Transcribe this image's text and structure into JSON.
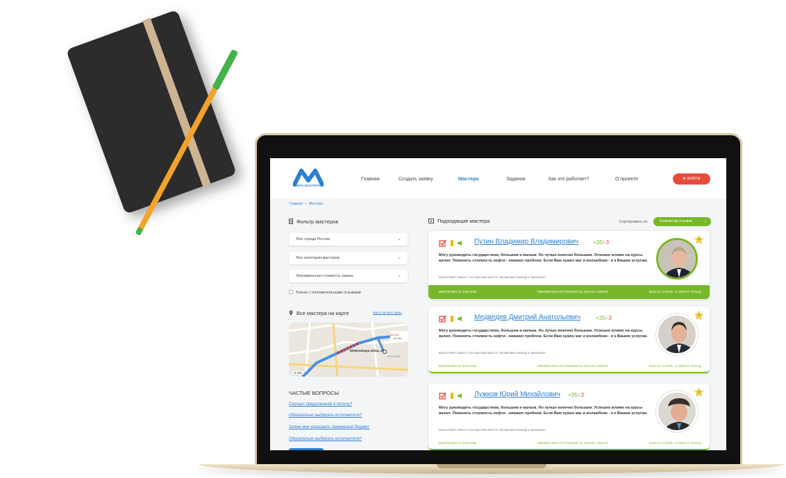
{
  "brand": {
    "logo_text": "БЮРО·МАСТЕРОВ"
  },
  "nav": {
    "items": [
      "Главная",
      "Создать заявку",
      "Мастера",
      "Задания",
      "Как это работает?",
      "О проекте"
    ],
    "active": "Мастера",
    "login_label": "ВОЙТИ"
  },
  "breadcrumb": [
    "Главная",
    "Мастера"
  ],
  "filter": {
    "title": "Фильтр мастеров",
    "city": "Все города России",
    "category": "Все категории мастеров",
    "min_cost": "Минимальная стоимость заказа",
    "positive_only": "Только с положительными отзывами"
  },
  "map": {
    "title": "Все мастера на карте",
    "fullscreen_link": "Карту на весь экран",
    "street": "Elektrodnaya ulitsa, 12",
    "eta": "8 min",
    "route_time": "38 min",
    "route_dist": "18,3 km",
    "district": "OVO DIST"
  },
  "faq": {
    "title": "ЧАСТЫЕ ВОПРОСЫ",
    "items": [
      "Сколько предложений я получу?",
      "Обязательно выбирать исполнителя?",
      "Зачем мне указывать примерный бюджет",
      "Обязательно выбирать исполнителя?"
    ]
  },
  "results": {
    "title": "Подходящие мастера",
    "sort_label": "Сортировать по",
    "sort_value": "Количеству отзывов",
    "cards": [
      {
        "name": "Путин Владимир Владимирович",
        "plus": "+35",
        "slash": "/",
        "minus": "-3",
        "description": "Могу руководить государством, большим и малым. Но лучше конечно большим. Успешно влияю на курсы валют. Поменять стоимость нефти - никаких проблем. Если Вам нужен маг и волшебник - я к Вашим услугам.",
        "work_place": "ВЫПОЛНЯЕТ РАБОТУ НА РАБОЧЕМ МЕСТЕ / ВОЗМОЖЕН ВЫЕЗД К ЗАКАЗЧИКУ",
        "orders": "ВЫПОЛНИЛ 12 ЗАКАЗОВ",
        "min_cost": "МИНИМАЛЬНАЯ СТОИМОСТЬ ЗАКАЗА 13000 ₽",
        "last_seen": "БЫЛ НА САЙТЕ: 17 МИНУТ НАЗАД",
        "badge": "10"
      },
      {
        "name": "Медведев Дмитрий Анатольевич",
        "plus": "+35",
        "slash": "/",
        "minus": "-3",
        "description": "Могу руководить государством, большим и малым. Но лучше конечно большим. Успешно влияю на курсы валют. Поменять стоимость нефти - никаких проблем. Если Вам нужен маг и волшебник - я к Вашим услугам.",
        "work_place": "ВЫПОЛНЯЕТ РАБОТУ НА РАБОЧЕМ МЕСТЕ / ВОЗМОЖЕН ВЫЕЗД К ЗАКАЗЧИКУ",
        "orders": "ВЫПОЛНИЛ 12 ЗАКАЗОВ",
        "min_cost": "МИНИМАЛЬНАЯ СТОИМОСТЬ ЗАКАЗА 13000 ₽",
        "last_seen": "БЫЛ НА САЙТЕ: 17 МИНУТ НАЗАД",
        "badge": "10"
      },
      {
        "name": "Лужков Юрий Михайлович",
        "plus": "+35",
        "slash": "/",
        "minus": "-3",
        "description": "Могу руководить государством, большим и малым. Но лучше конечно большим. Успешно влияю на курсы валют. Поменять стоимость нефти - никаких проблем. Если Вам нужен маг и волшебник - я к Вашим услугам.",
        "work_place": "ВЫПОЛНЯЕТ РАБОТУ НА РАБОЧЕМ МЕСТЕ / ВОЗМОЖЕН ВЫЕЗД К ЗАКАЗЧИКУ",
        "orders": "ВЫПОЛНИЛ 12 ЗАКАЗОВ",
        "min_cost": "МИНИМАЛЬНАЯ СТОИМОСТЬ ЗАКАЗА 13000 ₽",
        "last_seen": "БЫЛ НА САЙТЕ: 17 МИНУТ НАЗАД",
        "badge": "10"
      }
    ]
  },
  "colors": {
    "accent": "#2d7fd1",
    "green": "#77b82a",
    "red": "#e84a3c"
  }
}
